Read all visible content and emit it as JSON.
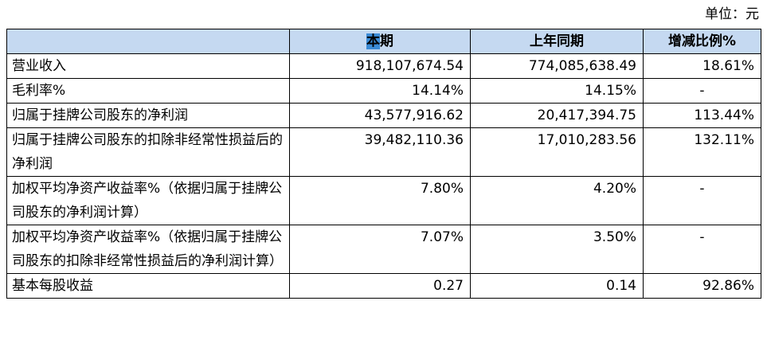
{
  "unit_label": "单位：元",
  "headers": {
    "item": "",
    "current_pre": "",
    "current_mark": "本",
    "current_post": "期",
    "previous": "上年同期",
    "change": "增减比例%"
  },
  "rows": [
    {
      "label": "营业收入",
      "current": "918,107,674.54",
      "previous": "774,085,638.49",
      "change": "18.61%"
    },
    {
      "label": "毛利率%",
      "current": "14.14%",
      "previous": "14.15%",
      "change": "-"
    },
    {
      "label": "归属于挂牌公司股东的净利润",
      "current": "43,577,916.62",
      "previous": "20,417,394.75",
      "change": "113.44%"
    },
    {
      "label": "归属于挂牌公司股东的扣除非经常性损益后的净利润",
      "current": "39,482,110.36",
      "previous": "17,010,283.56",
      "change": "132.11%"
    },
    {
      "label": "加权平均净资产收益率%（依据归属于挂牌公司股东的净利润计算）",
      "current": "7.80%",
      "previous": "4.20%",
      "change": "-"
    },
    {
      "label": "加权平均净资产收益率%（依据归属于挂牌公司股东的扣除非经常性损益后的净利润计算）",
      "current": "7.07%",
      "previous": "3.50%",
      "change": "-"
    },
    {
      "label": "基本每股收益",
      "current": "0.27",
      "previous": "0.14",
      "change": "92.86%"
    }
  ]
}
